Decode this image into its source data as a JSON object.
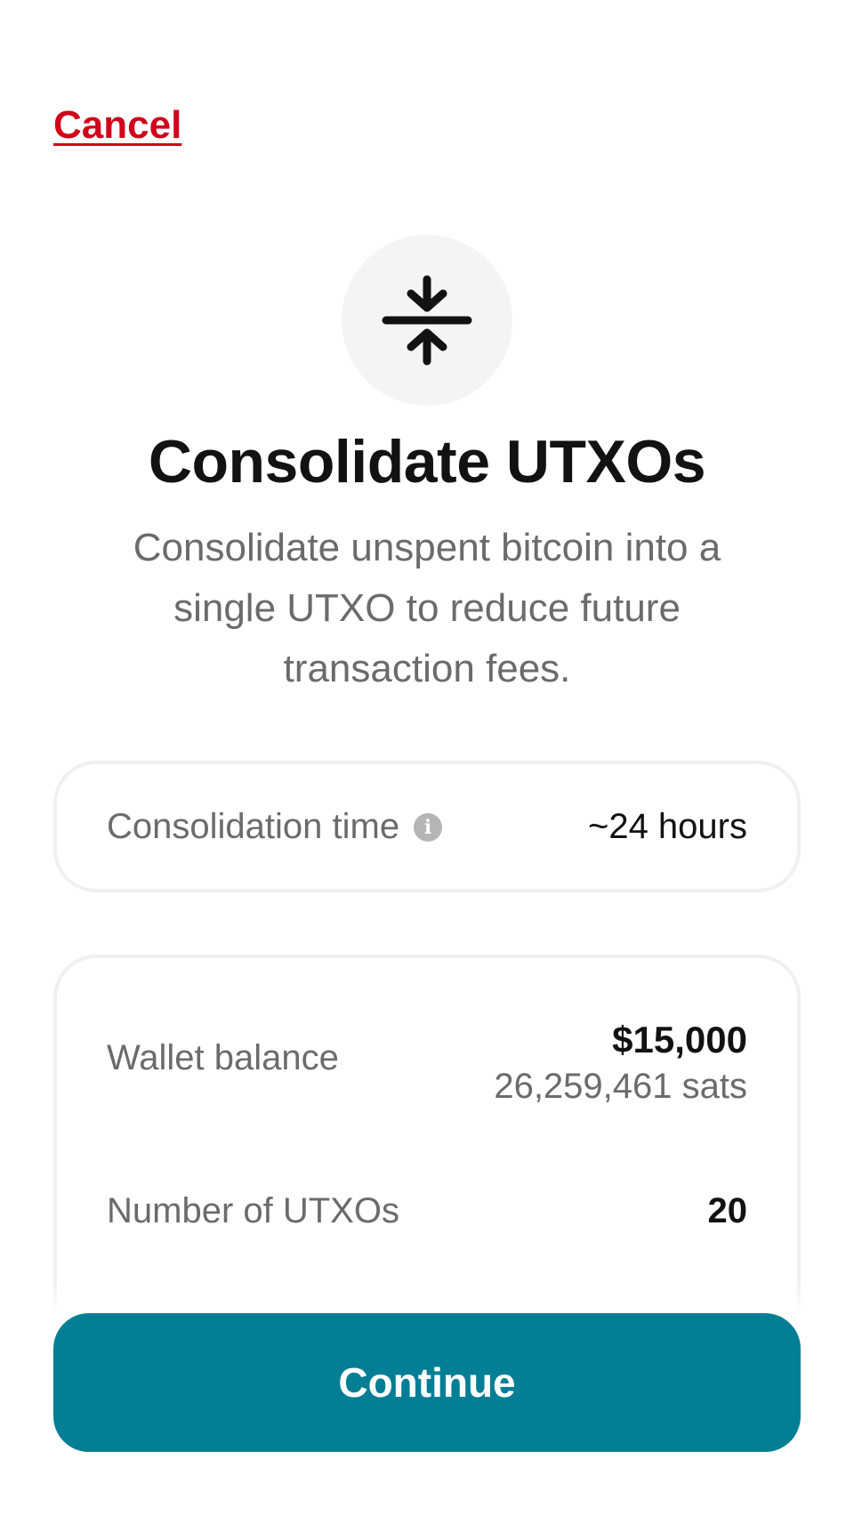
{
  "header": {
    "cancel_label": "Cancel"
  },
  "hero": {
    "icon": "compress-vertical-icon",
    "title": "Consolidate UTXOs",
    "description": "Consolidate unspent bitcoin into a single UTXO to reduce future transaction fees."
  },
  "consolidation": {
    "label": "Consolidation time",
    "info_icon": "info-icon",
    "info_glyph": "i",
    "value": "~24 hours"
  },
  "wallet": {
    "balance_label": "Wallet balance",
    "balance_usd": "$15,000",
    "balance_sats": "26,259,461 sats",
    "utxo_label": "Number of UTXOs",
    "utxo_count": "20"
  },
  "footer": {
    "continue_label": "Continue"
  },
  "colors": {
    "cancel": "#d0021b",
    "primary": "#037e95",
    "icon_bg": "#f4f4f4",
    "muted_text": "#6b6b6b"
  }
}
